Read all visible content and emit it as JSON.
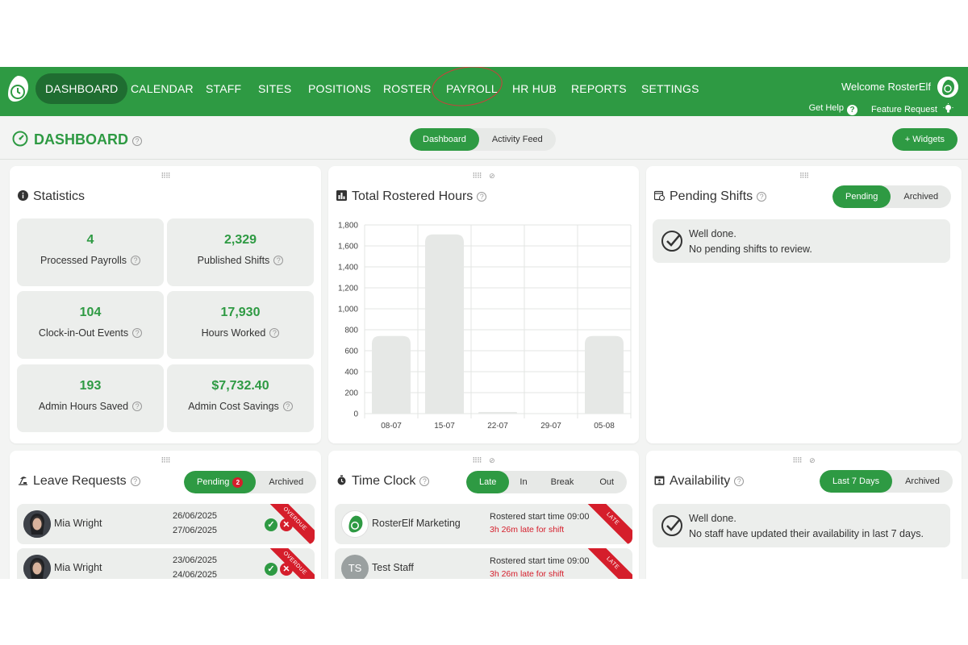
{
  "nav": {
    "items": [
      "DASHBOARD",
      "CALENDAR",
      "STAFF",
      "SITES",
      "POSITIONS",
      "ROSTER",
      "PAYROLL",
      "HR HUB",
      "REPORTS",
      "SETTINGS"
    ],
    "welcome": "Welcome RosterElf",
    "get_help": "Get Help",
    "feature_request": "Feature Request",
    "accent": "#2e9a43"
  },
  "header": {
    "title": "DASHBOARD",
    "tabs": [
      "Dashboard",
      "Activity Feed"
    ],
    "active_tab": "Dashboard",
    "widgets_button": "+ Widgets"
  },
  "statistics": {
    "title": "Statistics",
    "items": [
      {
        "value": "4",
        "label": "Processed Payrolls"
      },
      {
        "value": "2,329",
        "label": "Published Shifts"
      },
      {
        "value": "104",
        "label": "Clock-in-Out Events"
      },
      {
        "value": "17,930",
        "label": "Hours Worked"
      },
      {
        "value": "193",
        "label": "Admin Hours Saved"
      },
      {
        "value": "$7,732.40",
        "label": "Admin Cost Savings"
      }
    ]
  },
  "rostered_hours": {
    "title": "Total Rostered Hours",
    "chart_data": {
      "type": "bar",
      "categories": [
        "08-07",
        "15-07",
        "22-07",
        "29-07",
        "05-08"
      ],
      "values": [
        740,
        1710,
        15,
        0,
        740
      ],
      "ylim": [
        0,
        1800
      ],
      "yticks": [
        "0",
        "200",
        "400",
        "600",
        "800",
        "1,000",
        "1,200",
        "1,400",
        "1,600",
        "1,800"
      ],
      "grid": true
    }
  },
  "pending_shifts": {
    "title": "Pending Shifts",
    "tabs": [
      "Pending",
      "Archived"
    ],
    "message_title": "Well done.",
    "message_body": "No pending shifts to review."
  },
  "leave_requests": {
    "title": "Leave Requests",
    "tabs": [
      "Pending",
      "Archived"
    ],
    "pending_count": "2",
    "rows": [
      {
        "name": "Mia Wright",
        "from": "26/06/2025",
        "to": "27/06/2025",
        "ribbon": "OVERDUE"
      },
      {
        "name": "Mia Wright",
        "from": "23/06/2025",
        "to": "24/06/2025",
        "ribbon": "OVERDUE"
      }
    ]
  },
  "time_clock": {
    "title": "Time Clock",
    "tabs": [
      "Late",
      "In",
      "Break",
      "Out"
    ],
    "rows": [
      {
        "name": "RosterElf Marketing",
        "start": "Rostered start time 09:00",
        "late": "3h 26m late for shift",
        "ribbon": "LATE"
      },
      {
        "name": "Test Staff",
        "initials": "TS",
        "start": "Rostered start time 09:00",
        "late": "3h 26m late for shift",
        "ribbon": "LATE"
      }
    ]
  },
  "availability": {
    "title": "Availability",
    "tabs": [
      "Last 7 Days",
      "Archived"
    ],
    "message_title": "Well done.",
    "message_body": "No staff have updated their availability in last 7 days."
  }
}
